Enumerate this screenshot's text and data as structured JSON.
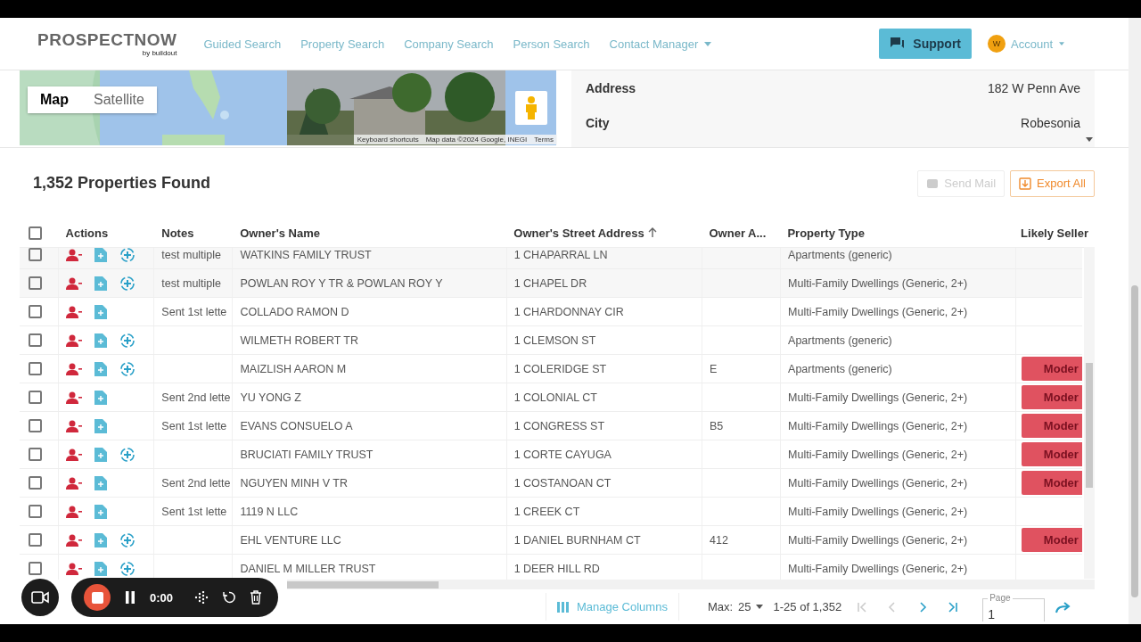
{
  "header": {
    "logo": "PROSPECTNOW",
    "logo_sub": "by buildout",
    "nav": [
      {
        "label": "Guided Search",
        "dropdown": false
      },
      {
        "label": "Property Search",
        "dropdown": false
      },
      {
        "label": "Company Search",
        "dropdown": false
      },
      {
        "label": "Person Search",
        "dropdown": false
      },
      {
        "label": "Contact Manager",
        "dropdown": true
      }
    ],
    "support": "Support",
    "avatar": "W",
    "account": "Account"
  },
  "map": {
    "toggle": [
      {
        "label": "Map",
        "selected": true
      },
      {
        "label": "Satellite",
        "selected": false
      }
    ],
    "footer": [
      "Keyboard shortcuts",
      "Map data ©2024 Google, INEGI",
      "Terms"
    ]
  },
  "details": [
    {
      "label": "Address",
      "value": "182 W Penn Ave"
    },
    {
      "label": "City",
      "value": "Robesonia"
    }
  ],
  "results": {
    "title": "1,352 Properties Found",
    "buttons": [
      {
        "label": "Send Mail",
        "kind": "mail",
        "disabled": true
      },
      {
        "label": "Export All",
        "kind": "export",
        "disabled": false
      }
    ]
  },
  "table": {
    "all_checked": false,
    "columns": [
      {
        "label": "Actions",
        "sorted_ascending": false
      },
      {
        "label": "Notes",
        "sorted_ascending": false
      },
      {
        "label": "Owner's Name",
        "sorted_ascending": false
      },
      {
        "label": "Owner's Street Address",
        "sorted_ascending": true
      },
      {
        "label": "Owner A...",
        "sorted_ascending": false
      },
      {
        "label": "Property Type",
        "sorted_ascending": false
      },
      {
        "label": "Likely Seller",
        "sorted_ascending": false
      }
    ],
    "rows": [
      {
        "checked": false,
        "locate_action": true,
        "notes": "test multiple",
        "name": "WATKINS FAMILY TRUST",
        "address": "1 CHAPARRAL LN",
        "owner_a": "",
        "type": "Apartments (generic)",
        "seller": ""
      },
      {
        "checked": false,
        "locate_action": true,
        "notes": "test multiple",
        "name": "POWLAN ROY Y TR & POWLAN ROY Y",
        "address": "1 CHAPEL DR",
        "owner_a": "",
        "type": "Multi-Family Dwellings (Generic, 2+)",
        "seller": ""
      },
      {
        "checked": false,
        "locate_action": false,
        "notes": "Sent 1st lette",
        "name": "COLLADO RAMON D",
        "address": "1 CHARDONNAY CIR",
        "owner_a": "",
        "type": "Multi-Family Dwellings (Generic, 2+)",
        "seller": ""
      },
      {
        "checked": false,
        "locate_action": true,
        "notes": "",
        "name": "WILMETH ROBERT TR",
        "address": "1 CLEMSON ST",
        "owner_a": "",
        "type": "Apartments (generic)",
        "seller": ""
      },
      {
        "checked": false,
        "locate_action": true,
        "notes": "",
        "name": "MAIZLISH AARON M",
        "address": "1 COLERIDGE ST",
        "owner_a": "E",
        "type": "Apartments (generic)",
        "seller": "Moder"
      },
      {
        "checked": false,
        "locate_action": false,
        "notes": "Sent 2nd lette",
        "name": "YU YONG Z",
        "address": "1 COLONIAL CT",
        "owner_a": "",
        "type": "Multi-Family Dwellings (Generic, 2+)",
        "seller": "Moder"
      },
      {
        "checked": false,
        "locate_action": false,
        "notes": "Sent 1st lette",
        "name": "EVANS CONSUELO A",
        "address": "1 CONGRESS ST",
        "owner_a": "B5",
        "type": "Multi-Family Dwellings (Generic, 2+)",
        "seller": "Moder"
      },
      {
        "checked": false,
        "locate_action": true,
        "notes": "",
        "name": "BRUCIATI FAMILY TRUST",
        "address": "1 CORTE CAYUGA",
        "owner_a": "",
        "type": "Multi-Family Dwellings (Generic, 2+)",
        "seller": "Moder"
      },
      {
        "checked": false,
        "locate_action": false,
        "notes": "Sent 2nd lette",
        "name": "NGUYEN MINH V TR",
        "address": "1 COSTANOAN CT",
        "owner_a": "",
        "type": "Multi-Family Dwellings (Generic, 2+)",
        "seller": "Moder"
      },
      {
        "checked": false,
        "locate_action": false,
        "notes": "Sent 1st lette",
        "name": "1119 N LLC",
        "address": "1 CREEK CT",
        "owner_a": "",
        "type": "Multi-Family Dwellings (Generic, 2+)",
        "seller": ""
      },
      {
        "checked": false,
        "locate_action": true,
        "notes": "",
        "name": "EHL VENTURE LLC",
        "address": "1 DANIEL BURNHAM CT",
        "owner_a": "412",
        "type": "Multi-Family Dwellings (Generic, 2+)",
        "seller": "Moder"
      },
      {
        "checked": false,
        "locate_action": true,
        "notes": "",
        "name": "DANIEL M MILLER TRUST",
        "address": "1 DEER HILL RD",
        "owner_a": "",
        "type": "Multi-Family Dwellings (Generic, 2+)",
        "seller": ""
      }
    ]
  },
  "footer": {
    "manage": "Manage Columns",
    "max_label": "Max:",
    "max_value": "25",
    "range": "1-25 of 1,352",
    "page_label": "Page",
    "page_value": "1",
    "pager": [
      {
        "kind": "first",
        "disabled": true
      },
      {
        "kind": "prev",
        "disabled": true
      },
      {
        "kind": "next",
        "disabled": false
      },
      {
        "kind": "last",
        "disabled": false
      }
    ]
  },
  "recorder": {
    "time": "0:00"
  }
}
